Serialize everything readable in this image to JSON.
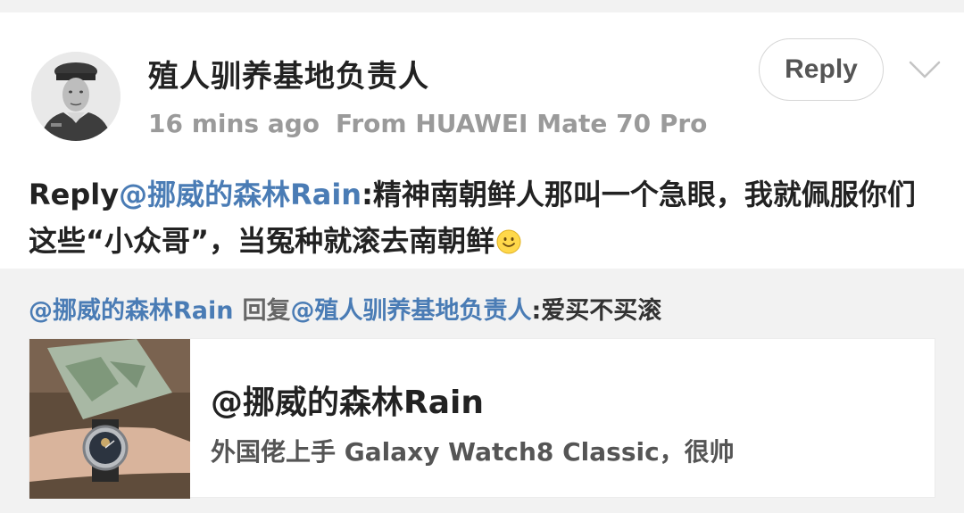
{
  "post": {
    "author": "殖人驯养基地负责人",
    "time": "16 mins ago",
    "source": "From HUAWEI Mate 70 Pro",
    "reply_button": "Reply",
    "reply_prefix": "Reply",
    "reply_mention": "@挪威的森林Rain",
    "reply_text": ":精神南朝鲜人那叫一个急眼，我就佩服你们这些“小众哥”，当冤种就滚去南朝鲜",
    "emoji": "smile-emoji-icon"
  },
  "quote": {
    "mention_from": "@挪威的森林Rain",
    "reply_word": "回复",
    "mention_to": "@殖人驯养基地负责人",
    "text": ":爱买不买滚"
  },
  "link_card": {
    "title": "@挪威的森林Rain",
    "description": "外国佬上手 Galaxy Watch8 Classic，很帅"
  },
  "colors": {
    "mention": "#4a7cb5",
    "text": "#222222",
    "meta": "#9a9a9a",
    "background": "#f2f2f2"
  }
}
